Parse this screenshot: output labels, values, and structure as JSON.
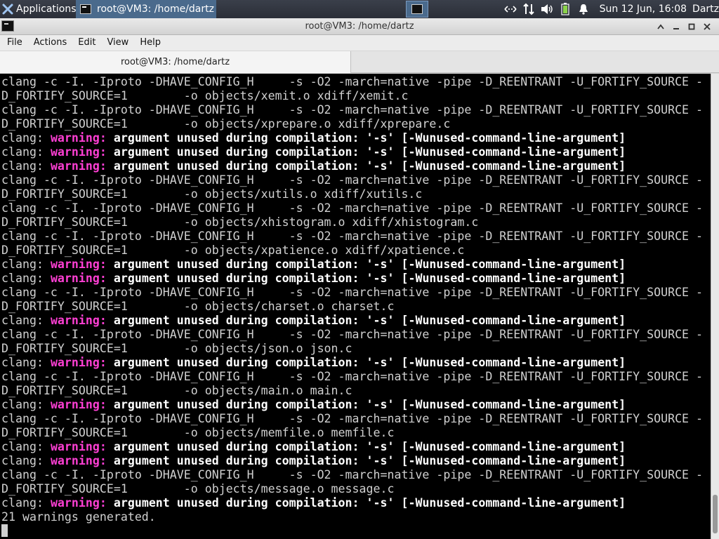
{
  "panel": {
    "apps_label": "Applications",
    "task_label": "root@VM3: /home/dartz",
    "clock": "Sun 12 Jun, 16:08",
    "user": "Dartz"
  },
  "window": {
    "title": "root@VM3: /home/dartz"
  },
  "menubar": {
    "file": "File",
    "actions": "Actions",
    "edit": "Edit",
    "view": "View",
    "help": "Help"
  },
  "tab": {
    "label": "root@VM3: /home/dartz"
  },
  "terminal": {
    "lines": [
      {
        "type": "cmd",
        "text": "clang -c -I. -Iproto -DHAVE_CONFIG_H     -s -O2 -march=native -pipe -D_REENTRANT -U_FORTIFY_SOURCE -"
      },
      {
        "type": "cmd",
        "text": "D_FORTIFY_SOURCE=1        -o objects/xemit.o xdiff/xemit.c"
      },
      {
        "type": "cmd",
        "text": "clang -c -I. -Iproto -DHAVE_CONFIG_H     -s -O2 -march=native -pipe -D_REENTRANT -U_FORTIFY_SOURCE -"
      },
      {
        "type": "cmd",
        "text": "D_FORTIFY_SOURCE=1        -o objects/xprepare.o xdiff/xprepare.c"
      },
      {
        "type": "warn",
        "prefix": "clang: ",
        "tag": "warning:",
        "msg": " argument unused during compilation: '-s' [-Wunused-command-line-argument]"
      },
      {
        "type": "warn",
        "prefix": "clang: ",
        "tag": "warning:",
        "msg": " argument unused during compilation: '-s' [-Wunused-command-line-argument]"
      },
      {
        "type": "warn",
        "prefix": "clang: ",
        "tag": "warning:",
        "msg": " argument unused during compilation: '-s' [-Wunused-command-line-argument]"
      },
      {
        "type": "cmd",
        "text": "clang -c -I. -Iproto -DHAVE_CONFIG_H     -s -O2 -march=native -pipe -D_REENTRANT -U_FORTIFY_SOURCE -"
      },
      {
        "type": "cmd",
        "text": "D_FORTIFY_SOURCE=1        -o objects/xutils.o xdiff/xutils.c"
      },
      {
        "type": "cmd",
        "text": "clang -c -I. -Iproto -DHAVE_CONFIG_H     -s -O2 -march=native -pipe -D_REENTRANT -U_FORTIFY_SOURCE -"
      },
      {
        "type": "cmd",
        "text": "D_FORTIFY_SOURCE=1        -o objects/xhistogram.o xdiff/xhistogram.c"
      },
      {
        "type": "cmd",
        "text": "clang -c -I. -Iproto -DHAVE_CONFIG_H     -s -O2 -march=native -pipe -D_REENTRANT -U_FORTIFY_SOURCE -"
      },
      {
        "type": "cmd",
        "text": "D_FORTIFY_SOURCE=1        -o objects/xpatience.o xdiff/xpatience.c"
      },
      {
        "type": "warn",
        "prefix": "clang: ",
        "tag": "warning:",
        "msg": " argument unused during compilation: '-s' [-Wunused-command-line-argument]"
      },
      {
        "type": "warn",
        "prefix": "clang: ",
        "tag": "warning:",
        "msg": " argument unused during compilation: '-s' [-Wunused-command-line-argument]"
      },
      {
        "type": "cmd",
        "text": "clang -c -I. -Iproto -DHAVE_CONFIG_H     -s -O2 -march=native -pipe -D_REENTRANT -U_FORTIFY_SOURCE -"
      },
      {
        "type": "cmd",
        "text": "D_FORTIFY_SOURCE=1        -o objects/charset.o charset.c"
      },
      {
        "type": "warn",
        "prefix": "clang: ",
        "tag": "warning:",
        "msg": " argument unused during compilation: '-s' [-Wunused-command-line-argument]"
      },
      {
        "type": "cmd",
        "text": "clang -c -I. -Iproto -DHAVE_CONFIG_H     -s -O2 -march=native -pipe -D_REENTRANT -U_FORTIFY_SOURCE -"
      },
      {
        "type": "cmd",
        "text": "D_FORTIFY_SOURCE=1        -o objects/json.o json.c"
      },
      {
        "type": "warn",
        "prefix": "clang: ",
        "tag": "warning:",
        "msg": " argument unused during compilation: '-s' [-Wunused-command-line-argument]"
      },
      {
        "type": "cmd",
        "text": "clang -c -I. -Iproto -DHAVE_CONFIG_H     -s -O2 -march=native -pipe -D_REENTRANT -U_FORTIFY_SOURCE -"
      },
      {
        "type": "cmd",
        "text": "D_FORTIFY_SOURCE=1        -o objects/main.o main.c"
      },
      {
        "type": "warn",
        "prefix": "clang: ",
        "tag": "warning:",
        "msg": " argument unused during compilation: '-s' [-Wunused-command-line-argument]"
      },
      {
        "type": "cmd",
        "text": "clang -c -I. -Iproto -DHAVE_CONFIG_H     -s -O2 -march=native -pipe -D_REENTRANT -U_FORTIFY_SOURCE -"
      },
      {
        "type": "cmd",
        "text": "D_FORTIFY_SOURCE=1        -o objects/memfile.o memfile.c"
      },
      {
        "type": "warn",
        "prefix": "clang: ",
        "tag": "warning:",
        "msg": " argument unused during compilation: '-s' [-Wunused-command-line-argument]"
      },
      {
        "type": "warn",
        "prefix": "clang: ",
        "tag": "warning:",
        "msg": " argument unused during compilation: '-s' [-Wunused-command-line-argument]"
      },
      {
        "type": "cmd",
        "text": "clang -c -I. -Iproto -DHAVE_CONFIG_H     -s -O2 -march=native -pipe -D_REENTRANT -U_FORTIFY_SOURCE -"
      },
      {
        "type": "cmd",
        "text": "D_FORTIFY_SOURCE=1        -o objects/message.o message.c"
      },
      {
        "type": "warn",
        "prefix": "clang: ",
        "tag": "warning:",
        "msg": " argument unused during compilation: '-s' [-Wunused-command-line-argument]"
      },
      {
        "type": "cmd",
        "text": "21 warnings generated."
      }
    ]
  },
  "icons": {
    "apps": "xfce-logo-icon",
    "task": "terminal-icon",
    "workspace": "workspace-icon",
    "network": "network-icon",
    "transfer": "transfer-arrows-icon",
    "volume": "volume-icon",
    "battery": "battery-icon",
    "notifications": "bell-icon"
  },
  "colors": {
    "terminal_bg": "#000000",
    "terminal_fg": "#d0d0d0",
    "warning": "#ff3fd4",
    "panel_active": "#4a6a8c"
  }
}
